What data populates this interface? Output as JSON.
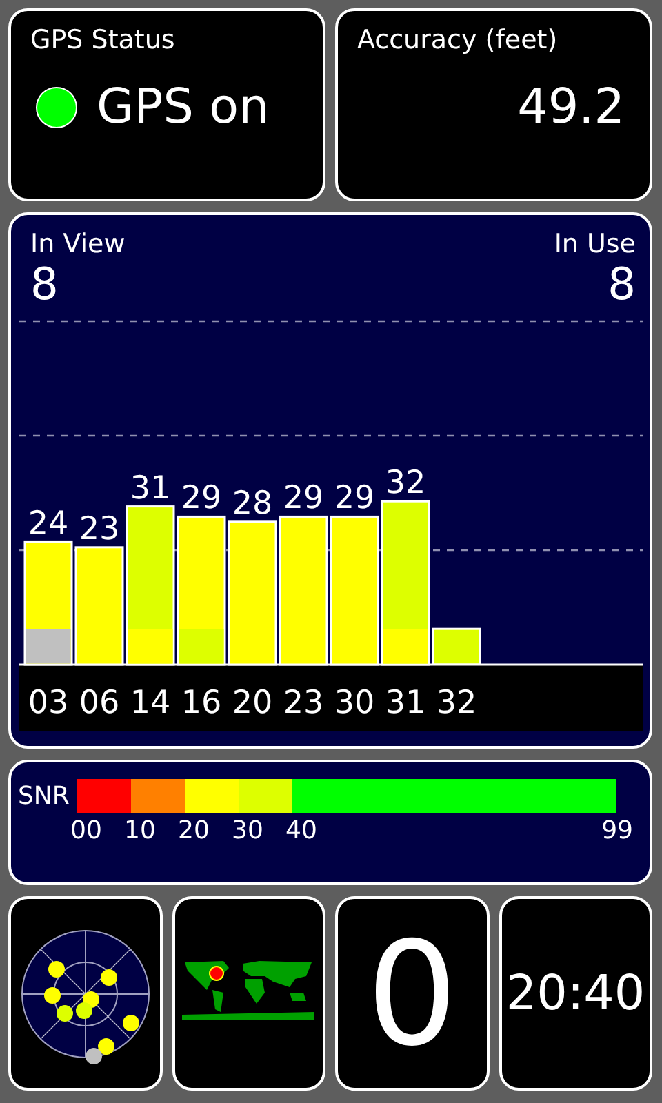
{
  "status": {
    "title": "GPS Status",
    "value": "GPS on",
    "on": true
  },
  "accuracy": {
    "title": "Accuracy (feet)",
    "value": "49.2"
  },
  "satellites": {
    "in_view_label": "In View",
    "in_view": "8",
    "in_use_label": "In Use",
    "in_use": "8",
    "chart_data": {
      "type": "bar",
      "categories": [
        "03",
        "06",
        "14",
        "16",
        "20",
        "23",
        "30",
        "31",
        "32"
      ],
      "series": [
        {
          "values": [
            24,
            23,
            31,
            29,
            28,
            29,
            29,
            32,
            null
          ]
        }
      ],
      "data_labels": true
    },
    "bars": [
      {
        "color": "#ffff00",
        "base": {
          "color": "#c0c0c0"
        }
      },
      {
        "color": "#ffff00"
      },
      {
        "color": "#ddff00",
        "base": {
          "color": "#ffff00"
        }
      },
      {
        "color": "#ffff00",
        "base": {
          "color": "#ddff00"
        }
      },
      {
        "color": "#ffff00"
      },
      {
        "color": "#ffff00"
      },
      {
        "color": "#ffff00"
      },
      {
        "color": "#ddff00",
        "base": {
          "color": "#ffff00"
        }
      },
      {
        "color": "#ddff00"
      }
    ]
  },
  "snr": {
    "label": "SNR",
    "segments": [
      {
        "color": "#ff0000"
      },
      {
        "color": "#ff8000"
      },
      {
        "color": "#ffff00"
      },
      {
        "color": "#ddff00"
      },
      {
        "color": "#00ff00"
      }
    ],
    "ticks": [
      "00",
      "10",
      "20",
      "30",
      "40",
      "99"
    ]
  },
  "counter": {
    "value": "0"
  },
  "clock": {
    "time": "20:40"
  }
}
